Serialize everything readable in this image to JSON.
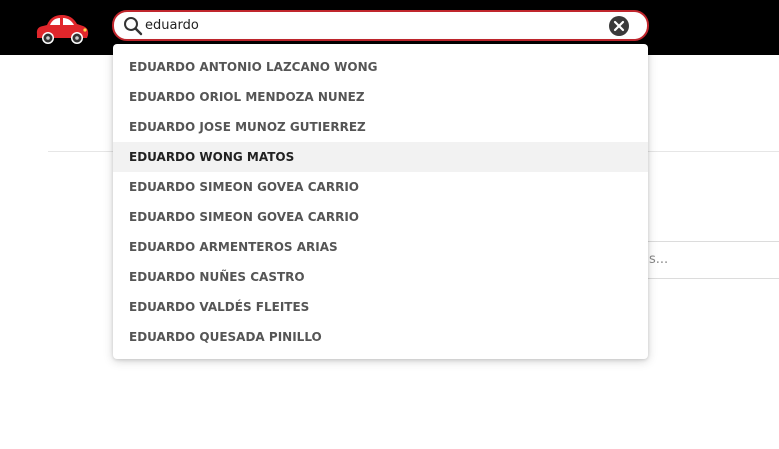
{
  "header": {
    "logo_icon": "red-car-icon",
    "search": {
      "value": "eduardo",
      "search_icon": "search-icon",
      "clear_icon": "close-circle-icon"
    }
  },
  "background": {
    "field_text": "s..."
  },
  "suggestions": [
    {
      "label": "EDUARDO ANTONIO LAZCANO WONG",
      "active": false
    },
    {
      "label": "EDUARDO ORIOL MENDOZA NUNEZ",
      "active": false
    },
    {
      "label": "EDUARDO JOSE MUNOZ GUTIERREZ",
      "active": false
    },
    {
      "label": "EDUARDO WONG MATOS",
      "active": true
    },
    {
      "label": "EDUARDO SIMEON GOVEA CARRIO",
      "active": false
    },
    {
      "label": "EDUARDO SIMEON GOVEA CARRIO",
      "active": false
    },
    {
      "label": "EDUARDO ARMENTEROS ARIAS",
      "active": false
    },
    {
      "label": "EDUARDO NUÑES CASTRO",
      "active": false
    },
    {
      "label": "EDUARDO VALDÉS FLEITES",
      "active": false
    },
    {
      "label": "EDUARDO QUESADA PINILLO",
      "active": false
    }
  ],
  "colors": {
    "header_bg": "#000000",
    "search_border": "#c0262d",
    "car_red": "#e0262b",
    "active_row": "#f2f2f2"
  }
}
